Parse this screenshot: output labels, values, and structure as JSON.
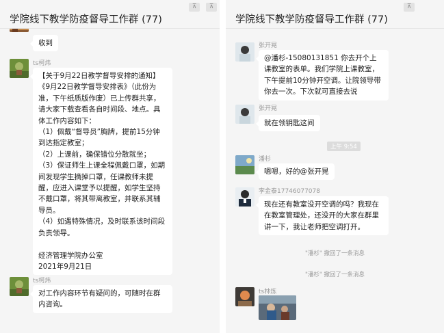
{
  "left": {
    "title": "学院线下教学防疫督导工作群 (77)",
    "pins": [
      "⊼",
      "⊼"
    ],
    "messages": [
      {
        "name": "",
        "text": "收到"
      },
      {
        "name": "ts柯炜",
        "text": "【关于9月22日教学督导安排的通知】\n《9月22日教学督导安排表》（此份为准，下午纸质版作废）已上传群共享，请大家下载查看各自时间段、地点。具体工作内容如下：\n（1）佩戴“督导员”胸牌，提前15分钟到达指定教室；\n（2）上课前，确保错位分散就坐；\n（3）保证师生上课全程佩戴口罩，如期间发现学生摘掉口罩，任课教师未提醒，应进入课堂予以提醒，如学生坚持不戴口罩，将其带离教室，并联系其辅导员。\n（4）如遇特殊情况，及时联系该时间段负责领导。\n\n经济管理学院办公室\n2021年9月21日"
      },
      {
        "name": "ts柯炜",
        "text": "对工作内容环节有疑问的，可随时在群内咨询。"
      }
    ]
  },
  "right": {
    "title": "学院线下教学防疫督导工作群 (77)",
    "pin": "⊼",
    "messages": [
      {
        "name": "张开晃",
        "text": "@潘杉-15080131851 你去开个上课教室的表单。我们学院上课教室，下午提前10分钟开空调。让院领导带你去一次。下次就可直接去说"
      },
      {
        "name": "张开晃",
        "text": "就在领钥匙这间"
      },
      {
        "name": "潘杉",
        "text": "嗯嗯，好的@张开晃"
      },
      {
        "name": "李金泰17746077078",
        "text": "现在还有教室没开空调的吗？我现在在教室管理处，还没开的大家在群里讲一下，我让老师把空调打开。"
      },
      {
        "name": "ts林炼",
        "text": ""
      }
    ],
    "time_pill": "上午 9:54",
    "system_notices": [
      "\"潘杉\" 撤回了一条消息",
      "\"潘杉\" 撤回了一条消息"
    ]
  }
}
